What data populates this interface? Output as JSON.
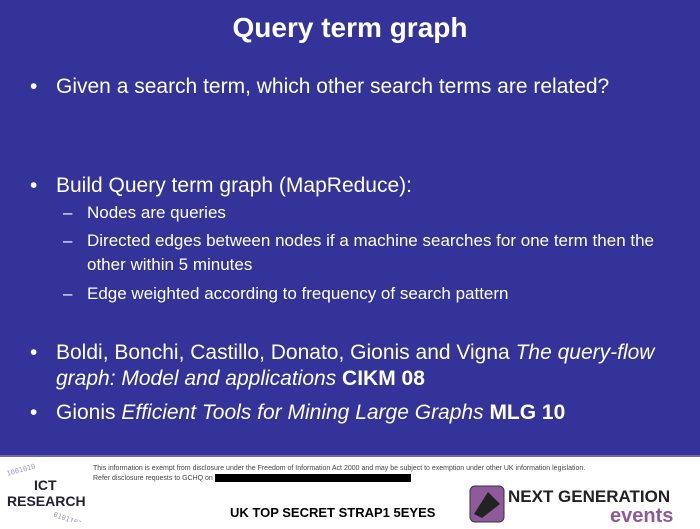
{
  "title": "Query term graph",
  "bullets": [
    {
      "text": "Given a search term, which other search terms are related?"
    },
    {
      "text": "Build Query term graph (MapReduce):",
      "sub": [
        "Nodes are queries",
        "Directed edges between nodes if a machine searches for one term then the other within 5 minutes",
        "Edge weighted according to frequency of search pattern"
      ]
    },
    {
      "authors": "Boldi, Bonchi, Castillo, Donato, Gionis and Vigna ",
      "title": "The query-flow graph: Model and applications",
      "venue": " CIKM 08"
    },
    {
      "authors": "Gionis ",
      "title": "Efficient Tools for Mining Large Graphs",
      "venue": " MLG 10"
    }
  ],
  "bullet_glyph": "•",
  "dash_glyph": "–",
  "footer": {
    "disclaimer": "This information is exempt from disclosure under the Freedom of Information Act 2000 and may be subject to exemption under other UK information legislation.",
    "refer": "Refer disclosure requests to GCHQ on ",
    "classification": "UK TOP SECRET STRAP1 5EYES",
    "logo_left": "ICT RESEARCH",
    "logo_right_1": "NEXT GENERATION",
    "logo_right_2": "events"
  },
  "colors": {
    "background": "#333399",
    "text": "#ffffff",
    "events": "#8e5a9c"
  }
}
